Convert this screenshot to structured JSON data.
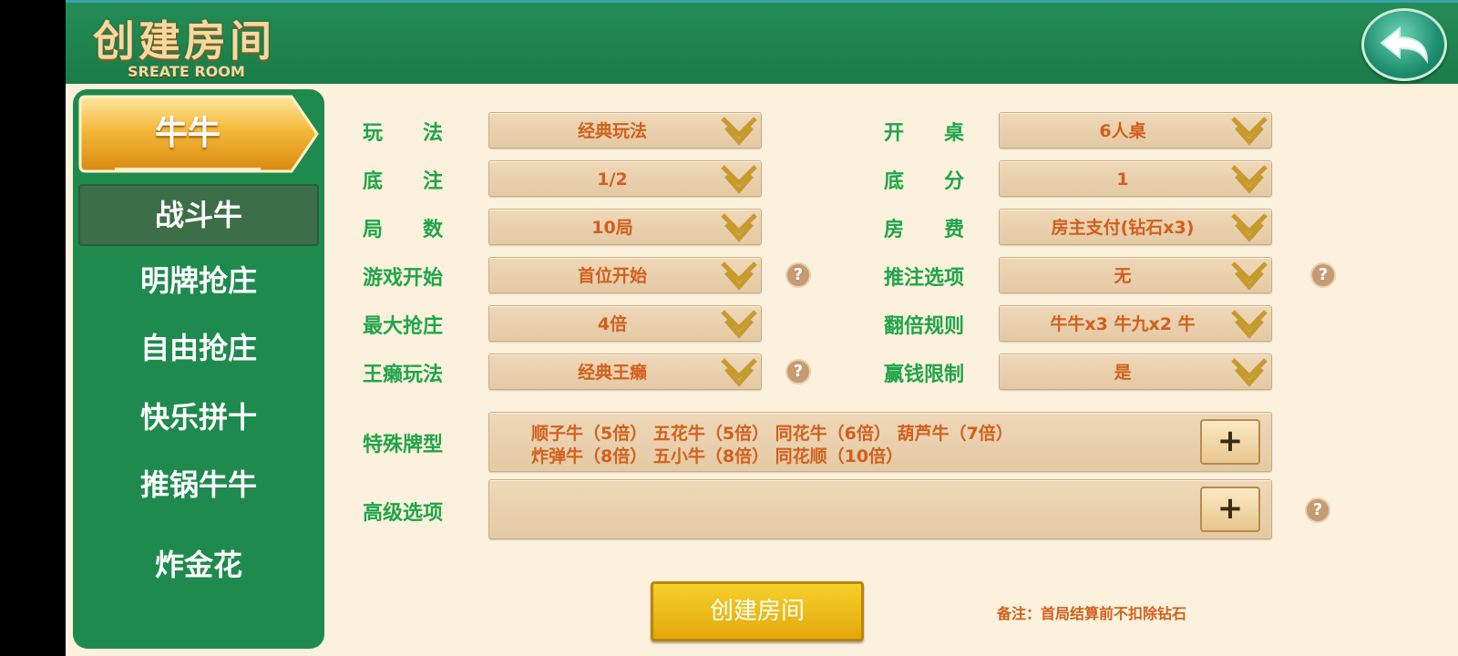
{
  "header": {
    "title": "创建房间",
    "subtitle": "SREATE ROOM",
    "back_icon": "back-arrow-icon"
  },
  "sidebar": {
    "items": [
      {
        "label": "牛牛"
      },
      {
        "label": "战斗牛"
      },
      {
        "label": "明牌抢庄"
      },
      {
        "label": "自由抢庄"
      },
      {
        "label": "快乐拼十"
      },
      {
        "label": "推锅牛牛"
      },
      {
        "label": "炸金花"
      }
    ]
  },
  "options": {
    "play_mode": {
      "label": "玩　　法",
      "value": "经典玩法"
    },
    "table_size": {
      "label": "开　　桌",
      "value": "6人桌"
    },
    "base_bet": {
      "label": "底　　注",
      "value": "1/2"
    },
    "base_score": {
      "label": "底　　分",
      "value": "1"
    },
    "rounds": {
      "label": "局　　数",
      "value": "10局"
    },
    "room_fee": {
      "label": "房　　费",
      "value": "房主支付(钻石x3)"
    },
    "game_start": {
      "label": "游戏开始",
      "value": "首位开始"
    },
    "push_bet": {
      "label": "推注选项",
      "value": "无"
    },
    "max_banker": {
      "label": "最大抢庄",
      "value": "4倍"
    },
    "double_rule": {
      "label": "翻倍规则",
      "value": "牛牛x3 牛九x2 牛"
    },
    "wild_mode": {
      "label": "王癞玩法",
      "value": "经典王癞"
    },
    "win_limit": {
      "label": "赢钱限制",
      "value": "是"
    },
    "special_cards": {
      "label": "特殊牌型",
      "line1": "顺子牛（5倍） 五花牛（5倍） 同花牛（6倍） 葫芦牛（7倍）",
      "line2": "炸弹牛（8倍） 五小牛（8倍） 同花顺（10倍）"
    },
    "advanced": {
      "label": "高级选项"
    }
  },
  "buttons": {
    "plus_label": "+",
    "help_label": "?",
    "create_label": "创建房间"
  },
  "remark": "备注：首局结算前不扣除钻石",
  "colors": {
    "header_green": "#1e8a4e",
    "label_green": "#1fa548",
    "value_orange": "#d25f1b",
    "panel_bg": "#fbf1dc",
    "create_gold": "#eec21a"
  }
}
